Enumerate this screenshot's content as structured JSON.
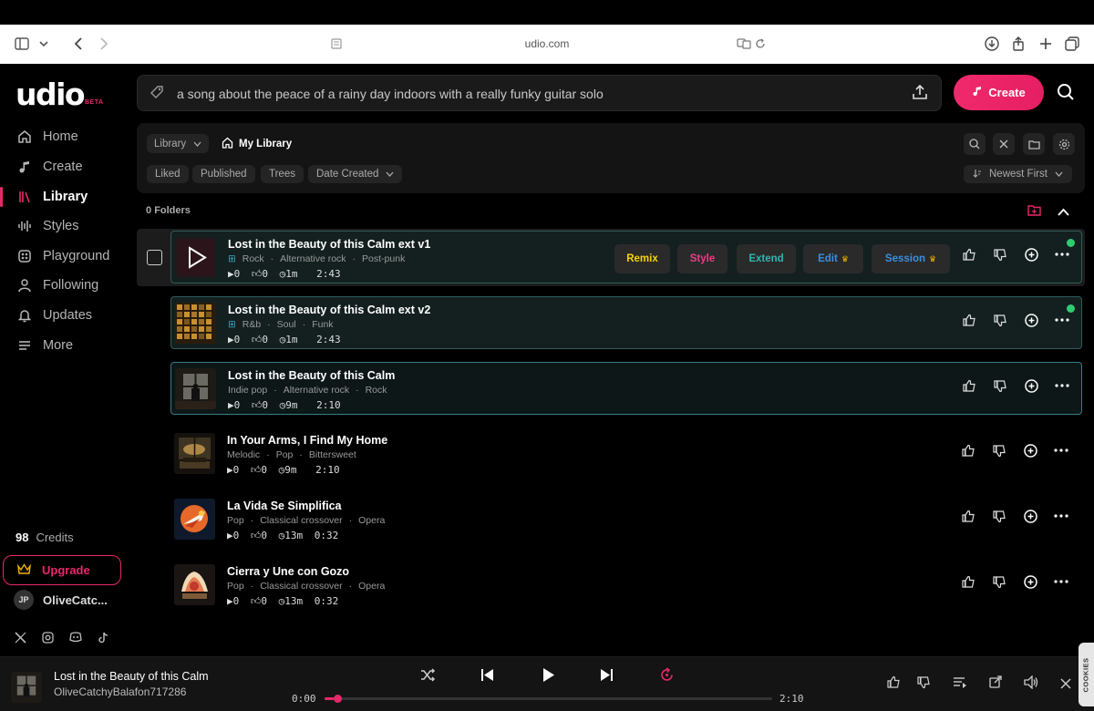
{
  "browser": {
    "url": "udio.com"
  },
  "brand": {
    "logo": "udio",
    "beta": "BETA",
    "accent": "#e8286b"
  },
  "sidebar": {
    "items": [
      {
        "label": "Home",
        "icon": "home-icon"
      },
      {
        "label": "Create",
        "icon": "music-note-icon"
      },
      {
        "label": "Library",
        "icon": "library-icon",
        "active": true
      },
      {
        "label": "Styles",
        "icon": "waveform-icon"
      },
      {
        "label": "Playground",
        "icon": "playground-icon"
      },
      {
        "label": "Following",
        "icon": "person-icon"
      },
      {
        "label": "Updates",
        "icon": "bell-icon"
      },
      {
        "label": "More",
        "icon": "menu-icon"
      }
    ],
    "credits_count": "98",
    "credits_label": "Credits",
    "upgrade": "Upgrade",
    "user_initials": "JP",
    "user_name": "OliveCatc..."
  },
  "prompt": {
    "text": "a song about the peace of a rainy day indoors with a really funky guitar solo",
    "create_label": "Create"
  },
  "library": {
    "crumb_library": "Library",
    "crumb_current": "My Library",
    "filters": [
      "Liked",
      "Published",
      "Trees",
      "Date Created"
    ],
    "sort": "Newest First",
    "folders_count": "0",
    "folders_label": "Folders"
  },
  "actions": {
    "remix": "Remix",
    "style": "Style",
    "extend": "Extend",
    "edit": "Edit",
    "session": "Session"
  },
  "tracks": [
    {
      "title": "Lost in the Beauty of this Calm ext v1",
      "tags": [
        "Rock",
        "Alternative rock",
        "Post-punk"
      ],
      "plays": "0",
      "likes": "0",
      "age": "1m",
      "duration": "2:43"
    },
    {
      "title": "Lost in the Beauty of this Calm ext v2",
      "tags": [
        "R&b",
        "Soul",
        "Funk"
      ],
      "plays": "0",
      "likes": "0",
      "age": "1m",
      "duration": "2:43"
    },
    {
      "title": "Lost in the Beauty of this Calm",
      "tags": [
        "Indie pop",
        "Alternative rock",
        "Rock"
      ],
      "plays": "0",
      "likes": "0",
      "age": "9m",
      "duration": "2:10"
    },
    {
      "title": "In Your Arms, I Find My Home",
      "tags": [
        "Melodic",
        "Pop",
        "Bittersweet"
      ],
      "plays": "0",
      "likes": "0",
      "age": "9m",
      "duration": "2:10"
    },
    {
      "title": "La Vida Se Simplifica",
      "tags": [
        "Pop",
        "Classical crossover",
        "Opera"
      ],
      "plays": "0",
      "likes": "0",
      "age": "13m",
      "duration": "0:32"
    },
    {
      "title": "Cierra y Une con Gozo",
      "tags": [
        "Pop",
        "Classical crossover",
        "Opera"
      ],
      "plays": "0",
      "likes": "0",
      "age": "13m",
      "duration": "0:32"
    }
  ],
  "player": {
    "title": "Lost in the Beauty of this Calm",
    "artist": "OliveCatchyBalafon717286",
    "current": "0:00",
    "total": "2:10",
    "progress": 0.02
  },
  "cookies": "COOKIES"
}
